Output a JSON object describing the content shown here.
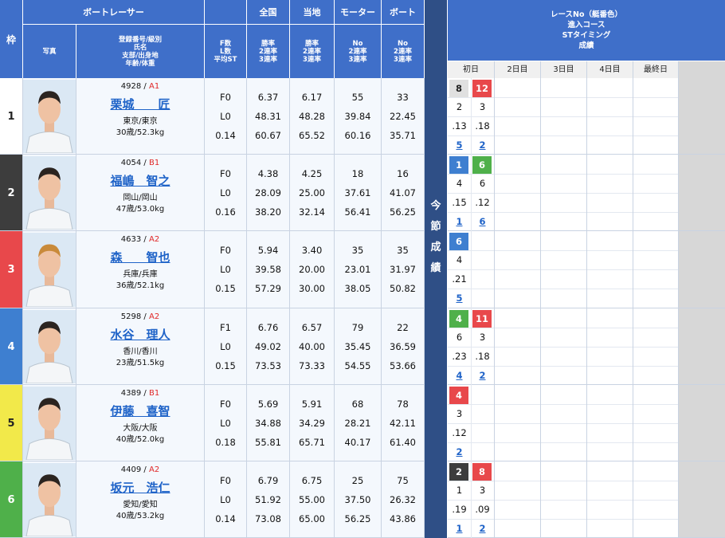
{
  "headers": {
    "waku": "枠",
    "racer": "ボートレーサー",
    "zenkoku": "全国",
    "touchi": "当地",
    "motor": "モーター",
    "boat": "ボート",
    "photo": "写真",
    "info_lines": [
      "登録番号/級別",
      "氏名",
      "支部/出身地",
      "年齢/体重"
    ],
    "fl_lines": [
      "F数",
      "L数",
      "平均ST"
    ],
    "rate_lines": [
      "勝率",
      "2連率",
      "3連率"
    ],
    "no_lines": [
      "No",
      "2連率",
      "3連率"
    ],
    "race_lines": [
      "レースNo（艇番色）",
      "進入コース",
      "STタイミング",
      "成績"
    ],
    "days": [
      "初日",
      "2日目",
      "3日目",
      "4日目",
      "最終日"
    ],
    "konsetsu": [
      "今",
      "節",
      "成",
      "績"
    ]
  },
  "colors": {
    "header_blue": "#3f6fc9",
    "waku": [
      "#ffffff",
      "#3d3d3d",
      "#e8484b",
      "#3e7fd0",
      "#f2e94a",
      "#4fb04a"
    ],
    "waku_text": [
      "#222222",
      "#ffffff",
      "#ffffff",
      "#ffffff",
      "#222222",
      "#ffffff"
    ]
  },
  "racers": [
    {
      "waku": "1",
      "reg": "4928",
      "cls": "A1",
      "name": "栗城　　匠",
      "branch": "東京/東京",
      "age_weight": "30歳/52.3kg",
      "f": "F0",
      "l": "L0",
      "st": "0.14",
      "zenkoku": [
        "6.37",
        "48.31",
        "60.67"
      ],
      "touchi": [
        "6.17",
        "48.28",
        "65.52"
      ],
      "motor": [
        "55",
        "39.84",
        "60.16"
      ],
      "boat": [
        "33",
        "22.45",
        "35.71"
      ],
      "races": [
        {
          "no": "8",
          "boat": 1,
          "course": "2",
          "st": ".13",
          "rank": "5"
        },
        {
          "no": "12",
          "boat": 3,
          "course": "3",
          "st": ".18",
          "rank": "2"
        }
      ]
    },
    {
      "waku": "2",
      "reg": "4054",
      "cls": "B1",
      "name": "福嶋　智之",
      "branch": "岡山/岡山",
      "age_weight": "47歳/53.0kg",
      "f": "F0",
      "l": "L0",
      "st": "0.16",
      "zenkoku": [
        "4.38",
        "28.09",
        "38.20"
      ],
      "touchi": [
        "4.25",
        "25.00",
        "32.14"
      ],
      "motor": [
        "18",
        "37.61",
        "56.41"
      ],
      "boat": [
        "16",
        "41.07",
        "56.25"
      ],
      "races": [
        {
          "no": "1",
          "boat": 4,
          "course": "4",
          "st": ".15",
          "rank": "1"
        },
        {
          "no": "6",
          "boat": 6,
          "course": "6",
          "st": ".12",
          "rank": "6"
        }
      ]
    },
    {
      "waku": "3",
      "reg": "4633",
      "cls": "A2",
      "name": "森　　智也",
      "branch": "兵庫/兵庫",
      "age_weight": "36歳/52.1kg",
      "f": "F0",
      "l": "L0",
      "st": "0.15",
      "zenkoku": [
        "5.94",
        "39.58",
        "57.29"
      ],
      "touchi": [
        "3.40",
        "20.00",
        "30.00"
      ],
      "motor": [
        "35",
        "23.01",
        "38.05"
      ],
      "boat": [
        "35",
        "31.97",
        "50.82"
      ],
      "races": [
        {
          "no": "6",
          "boat": 4,
          "course": "4",
          "st": ".21",
          "rank": "5"
        }
      ]
    },
    {
      "waku": "4",
      "reg": "5298",
      "cls": "A2",
      "name": "水谷　理人",
      "branch": "香川/香川",
      "age_weight": "23歳/51.5kg",
      "f": "F1",
      "l": "L0",
      "st": "0.15",
      "zenkoku": [
        "6.76",
        "49.02",
        "73.53"
      ],
      "touchi": [
        "6.57",
        "40.00",
        "73.33"
      ],
      "motor": [
        "79",
        "35.45",
        "54.55"
      ],
      "boat": [
        "22",
        "36.59",
        "53.66"
      ],
      "races": [
        {
          "no": "4",
          "boat": 6,
          "course": "6",
          "st": ".23",
          "rank": "4"
        },
        {
          "no": "11",
          "boat": 3,
          "course": "3",
          "st": ".18",
          "rank": "2"
        }
      ]
    },
    {
      "waku": "5",
      "reg": "4389",
      "cls": "B1",
      "name": "伊藤　喜智",
      "branch": "大阪/大阪",
      "age_weight": "40歳/52.0kg",
      "f": "F0",
      "l": "L0",
      "st": "0.18",
      "zenkoku": [
        "5.69",
        "34.88",
        "55.81"
      ],
      "touchi": [
        "5.91",
        "34.29",
        "65.71"
      ],
      "motor": [
        "68",
        "28.21",
        "40.17"
      ],
      "boat": [
        "78",
        "42.11",
        "61.40"
      ],
      "races": [
        {
          "no": "4",
          "boat": 3,
          "course": "3",
          "st": ".12",
          "rank": "2"
        }
      ]
    },
    {
      "waku": "6",
      "reg": "4409",
      "cls": "A2",
      "name": "坂元　浩仁",
      "branch": "愛知/愛知",
      "age_weight": "40歳/53.2kg",
      "f": "F0",
      "l": "L0",
      "st": "0.14",
      "zenkoku": [
        "6.79",
        "51.92",
        "73.08"
      ],
      "touchi": [
        "6.75",
        "55.00",
        "65.00"
      ],
      "motor": [
        "25",
        "37.50",
        "56.25"
      ],
      "boat": [
        "75",
        "26.32",
        "43.86"
      ],
      "races": [
        {
          "no": "2",
          "boat": 2,
          "course": "1",
          "st": ".19",
          "rank": "1"
        },
        {
          "no": "8",
          "boat": 3,
          "course": "3",
          "st": ".09",
          "rank": "2"
        }
      ]
    }
  ]
}
